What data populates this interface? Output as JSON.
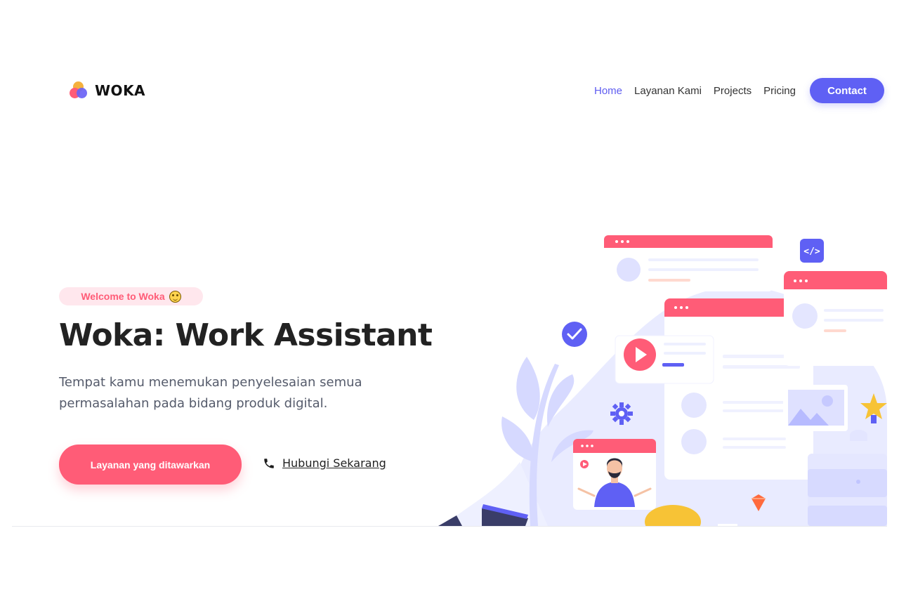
{
  "brand": {
    "name": "WOKA"
  },
  "nav": {
    "items": [
      {
        "label": "Home",
        "active": true
      },
      {
        "label": "Layanan Kami",
        "active": false
      },
      {
        "label": "Projects",
        "active": false
      },
      {
        "label": "Pricing",
        "active": false
      }
    ],
    "contact_label": "Contact"
  },
  "hero": {
    "badge": "Welcome to Woka",
    "title": "Woka: Work Assistant",
    "subtitle": "Tempat kamu menemukan penyelesaian semua permasalahan pada bidang produk digital.",
    "primary_cta": "Layanan yang ditawarkan",
    "secondary_cta": "Hubungi Sekarang"
  },
  "illustration": {
    "code_badge": "</>"
  },
  "colors": {
    "accent_blue": "#5f60f4",
    "accent_pink": "#ff5c77",
    "text_dark": "#222222",
    "text_muted": "#555b6b"
  }
}
